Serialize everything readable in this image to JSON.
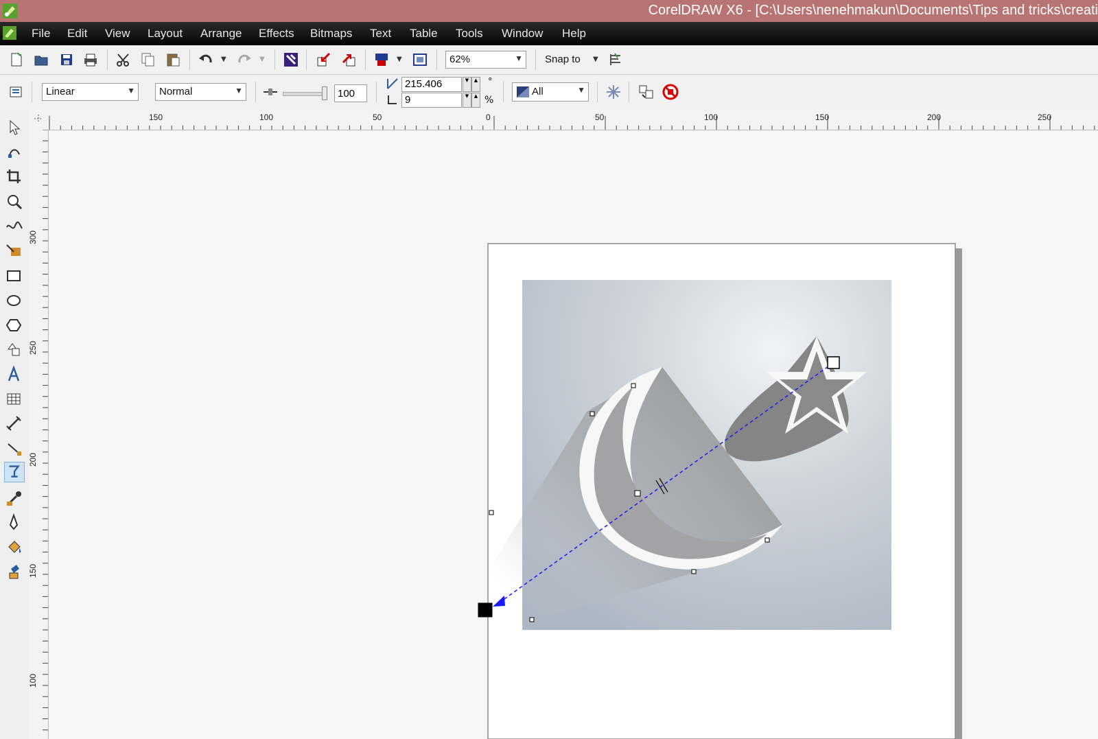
{
  "window": {
    "title": "CorelDRAW X6 - [C:\\Users\\nenehmakun\\Documents\\Tips and tricks\\creati"
  },
  "menu": {
    "items": [
      "File",
      "Edit",
      "View",
      "Layout",
      "Arrange",
      "Effects",
      "Bitmaps",
      "Text",
      "Table",
      "Tools",
      "Window",
      "Help"
    ]
  },
  "standard_toolbar": {
    "zoom_value": "62%",
    "snap_to_label": "Snap to"
  },
  "property_bar": {
    "fill_type": "Linear",
    "merge_mode": "Normal",
    "transparency_value": "100",
    "angle_value": "215.406",
    "angle_unit": "°",
    "edge_pad_value": "9",
    "edge_pad_unit": "%",
    "apply_to": "All"
  },
  "rulers": {
    "horizontal_labels": [
      "150",
      "100",
      "50",
      "0",
      "50",
      "100",
      "150",
      "200",
      "250"
    ],
    "vertical_labels": [
      "300",
      "250",
      "200",
      "150",
      "100"
    ]
  },
  "icons": {
    "standard": [
      "new-document-icon",
      "open-icon",
      "save-icon",
      "print-icon",
      "cut-icon",
      "copy-icon",
      "paste-icon",
      "undo-icon",
      "redo-icon",
      "search-content-icon",
      "import-icon",
      "export-icon",
      "publish-pdf-icon",
      "app-launcher-icon",
      "snap-options-icon"
    ],
    "tools": [
      "pick-tool-icon",
      "shape-tool-icon",
      "crop-tool-icon",
      "zoom-tool-icon",
      "freehand-tool-icon",
      "smart-fill-tool-icon",
      "rectangle-tool-icon",
      "ellipse-tool-icon",
      "polygon-tool-icon",
      "basic-shapes-tool-icon",
      "text-tool-icon",
      "table-tool-icon",
      "dimension-tool-icon",
      "connector-tool-icon",
      "transparency-tool-icon",
      "eyedropper-tool-icon",
      "outline-tool-icon",
      "fill-tool-icon",
      "interactive-fill-tool-icon"
    ]
  },
  "colors": {
    "titlebar": "#b87373",
    "menubar": "#111111",
    "vector_line": "#1a1aff",
    "artwork_bg_top": "#dfe3e8",
    "artwork_bg_bottom": "#b5bfca",
    "shape_gray": "#8a8a8a"
  }
}
